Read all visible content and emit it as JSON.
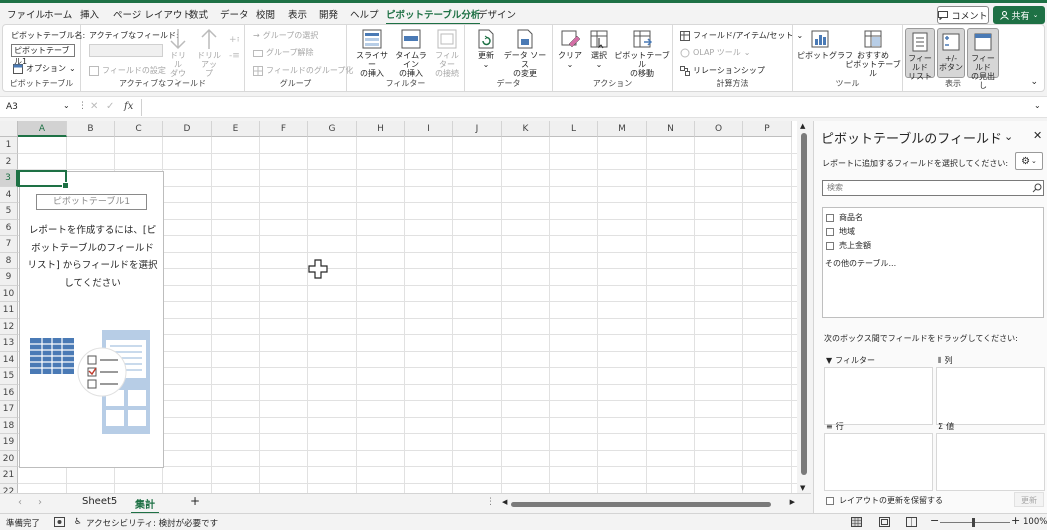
{
  "menu_tabs": [
    "ファイル",
    "ホーム",
    "挿入",
    "ページ レイアウト",
    "数式",
    "データ",
    "校閲",
    "表示",
    "開発",
    "ヘルプ",
    "ピボットテーブル分析",
    "デザイン"
  ],
  "active_tab_index": 10,
  "comment_label": "コメント",
  "share_label": "共有",
  "ribbon": {
    "pivot": {
      "name_label": "ピボットテーブル名:",
      "name_value": "ピボットテーブル1",
      "options_label": "オプション",
      "group_label": "ピボットテーブル"
    },
    "active_field": {
      "label": "アクティブなフィールド:",
      "drilldown": "ドリル\nダウン",
      "drillup": "ドリルアッ\nプ",
      "settings": "フィールドの設定",
      "group_label": "アクティブなフィールド"
    },
    "group": {
      "select": "グループの選択",
      "ungroup": "グループ解除",
      "field_group": "フィールドのグループ化",
      "group_label": "グループ"
    },
    "filter": {
      "slicer": "スライサー\nの挿入",
      "timeline": "タイムライン\nの挿入",
      "connection": "フィルター\nの接続",
      "group_label": "フィルター"
    },
    "data": {
      "refresh": "更新",
      "source": "データ ソース\nの変更",
      "group_label": "データ"
    },
    "actions": {
      "clear": "クリア",
      "select": "選択",
      "move": "ピボットテーブル\nの移動",
      "group_label": "アクション"
    },
    "calc": {
      "fields_items": "フィールド/アイテム/セット",
      "olap": "OLAP ツール",
      "relations": "リレーションシップ",
      "group_label": "計算方法"
    },
    "tools": {
      "chart": "ピボットグラフ",
      "recommended": "おすすめ\nピボットテーブル",
      "group_label": "ツール"
    },
    "show": {
      "field_list": "フィールド\nリスト",
      "buttons": "+/-\nボタン",
      "headers": "フィールド\nの見出し",
      "group_label": "表示"
    }
  },
  "formula_bar": {
    "name_box": "A3",
    "fx": "fx",
    "formula": ""
  },
  "columns": [
    "A",
    "B",
    "C",
    "D",
    "E",
    "F",
    "G",
    "H",
    "I",
    "J",
    "K",
    "L",
    "M",
    "N",
    "O",
    "P"
  ],
  "rows": [
    "1",
    "2",
    "3",
    "4",
    "5",
    "6",
    "7",
    "8",
    "9",
    "10",
    "11",
    "12",
    "13",
    "14",
    "15",
    "16",
    "17",
    "18",
    "19",
    "20",
    "21",
    "22"
  ],
  "selected_cell": {
    "column": "A",
    "row": "3"
  },
  "pivot_placeholder": {
    "label": "ピボットテーブル1",
    "message_lines": [
      "レポートを作成するには、[ピ",
      "ボットテーブルのフィールド",
      "リスト] からフィールドを選択",
      "してください"
    ]
  },
  "sheets": {
    "tabs": [
      "Sheet5",
      "集計"
    ],
    "active_index": 1,
    "add": "+"
  },
  "status": {
    "ready": "準備完了",
    "accessibility": "アクセシビリティ: 検討が必要です",
    "zoom": "100%"
  },
  "pane": {
    "title": "ピボットテーブルのフィールド",
    "subtitle": "レポートに追加するフィールドを選択してください:",
    "search_placeholder": "検索",
    "fields": [
      "商品名",
      "地域",
      "売上金額"
    ],
    "more_tables": "その他のテーブル...",
    "drag_hint": "次のボックス間でフィールドをドラッグしてください:",
    "areas": {
      "filter": "フィルター",
      "columns": "列",
      "rows": "行",
      "values": "値"
    },
    "defer_label": "レイアウトの更新を保留する",
    "update_label": "更新"
  },
  "colors": {
    "accent": "#1e7145",
    "selected_header": "#d2d2d2",
    "pivot_icon_blue": "#4a7ab5",
    "pivot_icon_light": "#b7cde6"
  }
}
